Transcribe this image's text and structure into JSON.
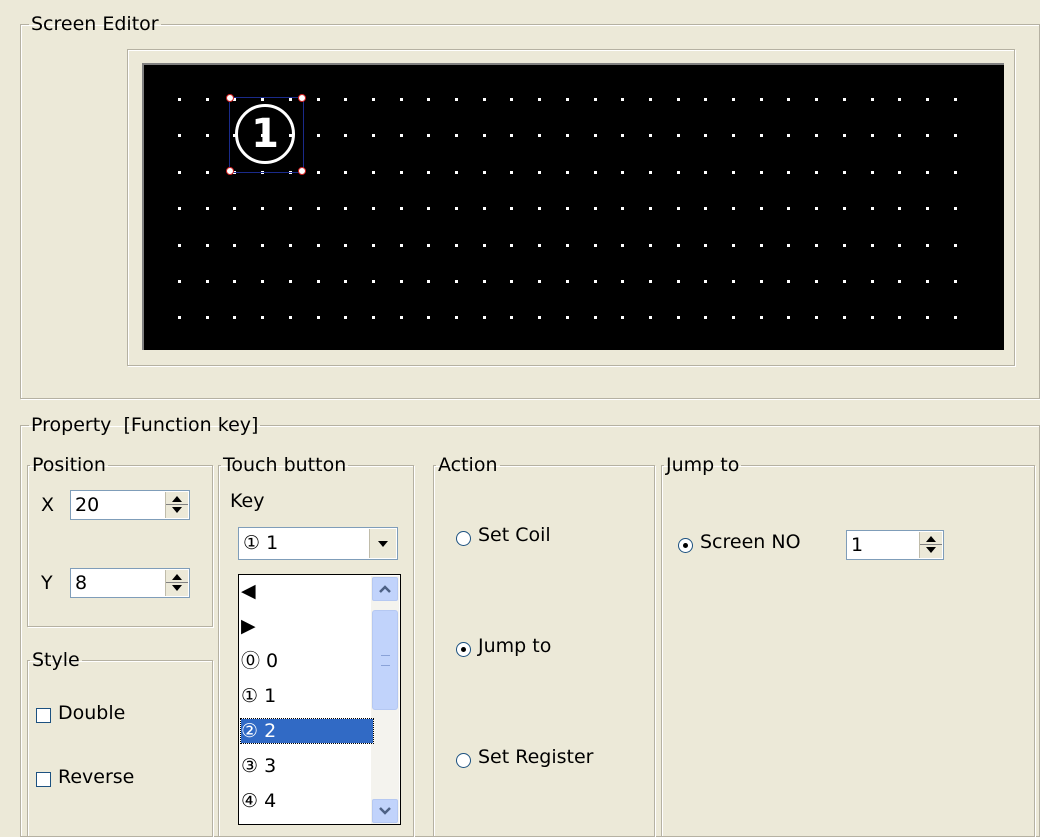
{
  "screen_editor": {
    "title": "Screen Editor",
    "selected_key_glyph": "①"
  },
  "property": {
    "title": "Property  [Function key]",
    "position": {
      "title": "Position",
      "x_label": "X",
      "x_value": "20",
      "y_label": "Y",
      "y_value": "8"
    },
    "style": {
      "title": "Style",
      "double_label": "Double",
      "reverse_label": "Reverse"
    },
    "touch_button": {
      "title": "Touch button",
      "key_label": "Key",
      "key_value": "① 1",
      "options": [
        "◀",
        "▶",
        "⓪ 0",
        "① 1",
        "② 2",
        "③ 3",
        "④ 4"
      ],
      "highlighted_option": "② 2"
    },
    "action": {
      "title": "Action",
      "set_coil": "Set Coil",
      "jump_to": "Jump to",
      "set_register": "Set Register",
      "selected": "Jump to"
    },
    "jump_to": {
      "title": "Jump to",
      "screen_no_label": "Screen NO",
      "screen_no_value": "1"
    }
  }
}
